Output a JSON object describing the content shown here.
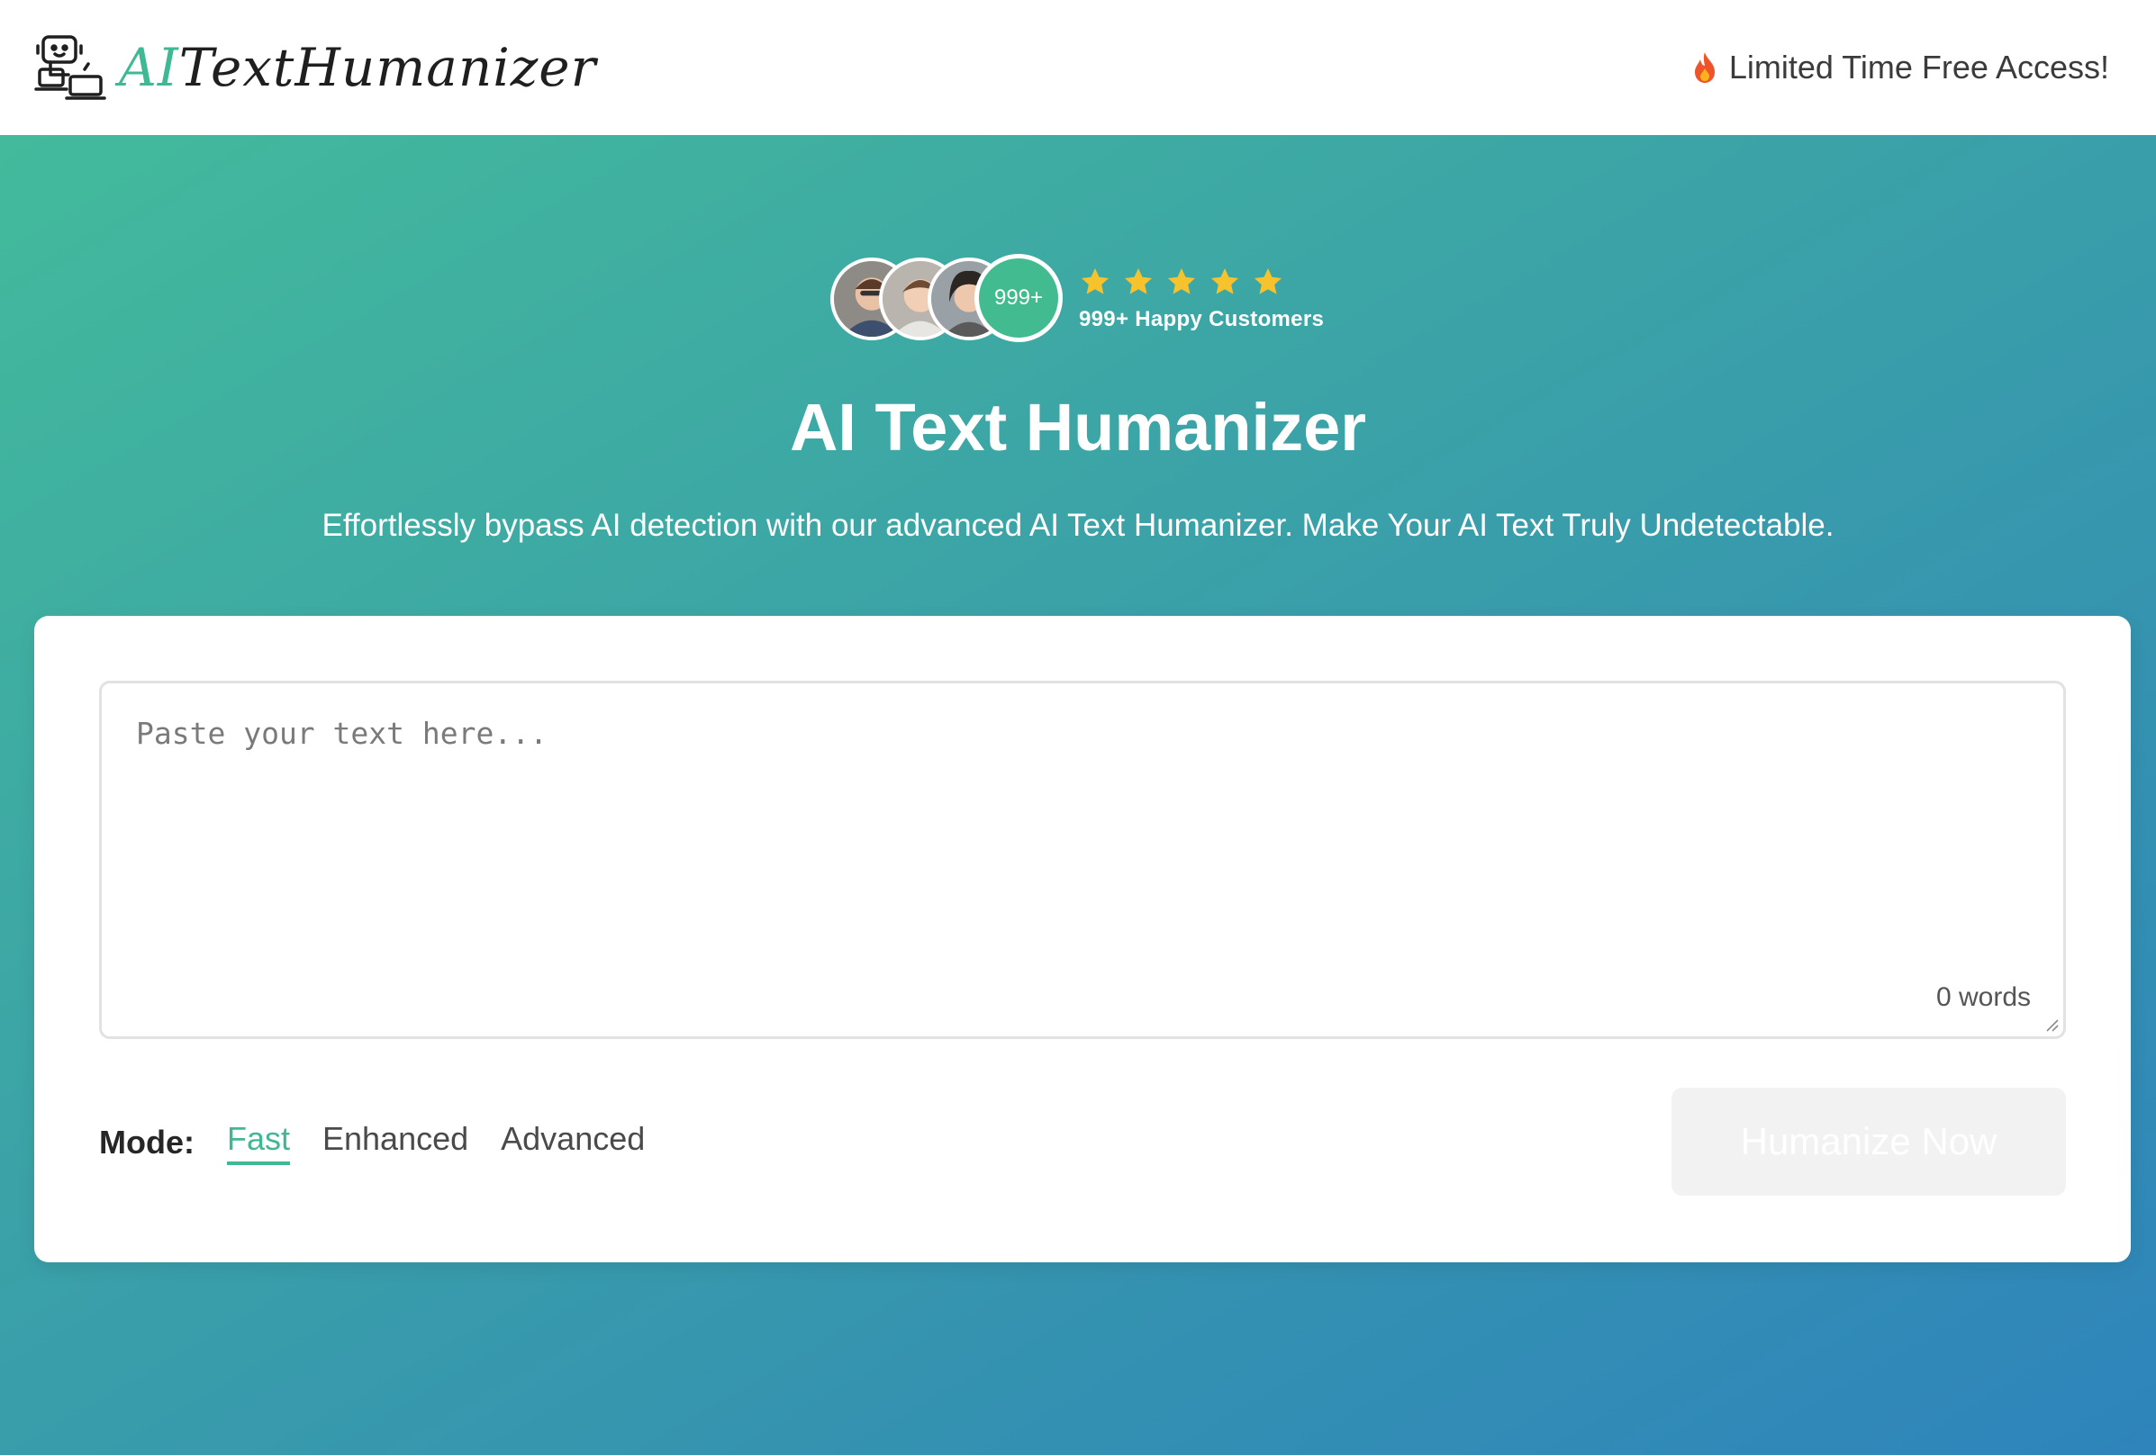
{
  "header": {
    "logo_ai": "AI",
    "logo_rest": "TextHumanizer",
    "promo_text": "Limited Time Free Access!"
  },
  "social_proof": {
    "badge_count": "999+",
    "rating_stars": 5,
    "customers_text": "999+ Happy Customers"
  },
  "hero": {
    "title": "AI Text Humanizer",
    "subtitle": "Effortlessly bypass AI detection with our advanced AI Text Humanizer. Make Your AI Text Truly Undetectable."
  },
  "editor": {
    "placeholder": "Paste your text here...",
    "value": "",
    "word_count": "0 words"
  },
  "mode": {
    "label": "Mode:",
    "options": [
      "Fast",
      "Enhanced",
      "Advanced"
    ],
    "selected": "Fast"
  },
  "actions": {
    "humanize_label": "Humanize Now"
  },
  "colors": {
    "accent": "#3fb894",
    "star": "#f6c32d",
    "gradient_start": "#44bd9a",
    "gradient_end": "#2e84bb"
  },
  "icons": {
    "logo": "robot-laptop-icon",
    "promo": "fire-icon",
    "rating": "star-icon"
  }
}
